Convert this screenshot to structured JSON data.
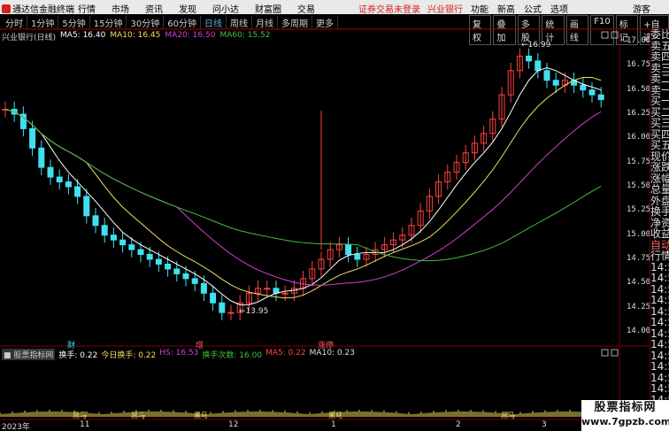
{
  "app": {
    "title": "通达信金融终端"
  },
  "menu": [
    "行情",
    "市场",
    "资讯",
    "发现",
    "问小达",
    "财富圈",
    "交易"
  ],
  "notice": {
    "text": "证券交易未登录",
    "stock": "兴业银行"
  },
  "rmenu": [
    "功能",
    "新高",
    "公式",
    "选项"
  ],
  "guest": "游客",
  "periods": [
    "分时",
    "1分钟",
    "5分钟",
    "15分钟",
    "30分钟",
    "60分钟",
    "日线",
    "周线",
    "月线",
    "多周期",
    "更多"
  ],
  "active_period": "日线",
  "tools": [
    "复权",
    "叠加",
    "多股",
    "统计",
    "画线",
    "F10",
    "标记",
    "+自选"
  ],
  "main_title": {
    "name": "兴业银行(日线)",
    "ma5": "MA5: 16.40",
    "ma10": "MA10: 16.45",
    "ma20": "MA20: 16.50",
    "ma60": "MA60: 15.52"
  },
  "colors": {
    "ma5": "#ffffff",
    "ma10": "#f0e060",
    "ma20": "#d040d0",
    "ma60": "#40c040",
    "up": "#ff4040",
    "down": "#40e0f0"
  },
  "y_ticks": [
    "17.00",
    "16.75",
    "16.50",
    "16.25",
    "16.00",
    "15.75",
    "15.50",
    "15.25",
    "15.00",
    "14.75",
    "14.50",
    "14.25",
    "14.00"
  ],
  "annotations": {
    "high": "16.99",
    "low": "13.95"
  },
  "markers": [
    "财",
    "增",
    "涨停"
  ],
  "quote_labels": [
    "委比",
    "卖五",
    "卖四",
    "卖三",
    "卖二",
    "卖一",
    "买一",
    "买二",
    "买三",
    "买四",
    "买五",
    "现价",
    "涨跌",
    "涨幅",
    "总量",
    "外盘",
    "换手",
    "净资",
    "收益",
    "自动",
    "行情",
    "14:5",
    "14:5",
    "14:5",
    "14:5",
    "14:5",
    "14:5",
    "14:5",
    "14:5",
    "14:5",
    "14:5",
    "14:5",
    "14:5",
    "14:5",
    "14:5",
    "14:5"
  ],
  "sub_title": {
    "name": "股票指标网",
    "huanshou": "换手: 0.22",
    "today": "今日换手: 0.22",
    "hs": "HS: 16.53",
    "count": "换手次数: 16.00",
    "ma5": "MA5: 0.22",
    "ma10": "MA10: 0.23"
  },
  "sub_labels": [
    "黑马",
    "黑马",
    "黑马",
    "黑马",
    "黑马"
  ],
  "dates": [
    "2023年",
    "11",
    "12",
    "1",
    "2",
    "3"
  ],
  "watermark": {
    "line1": "股票指标网",
    "line2": "www.7gpzb.com"
  }
}
